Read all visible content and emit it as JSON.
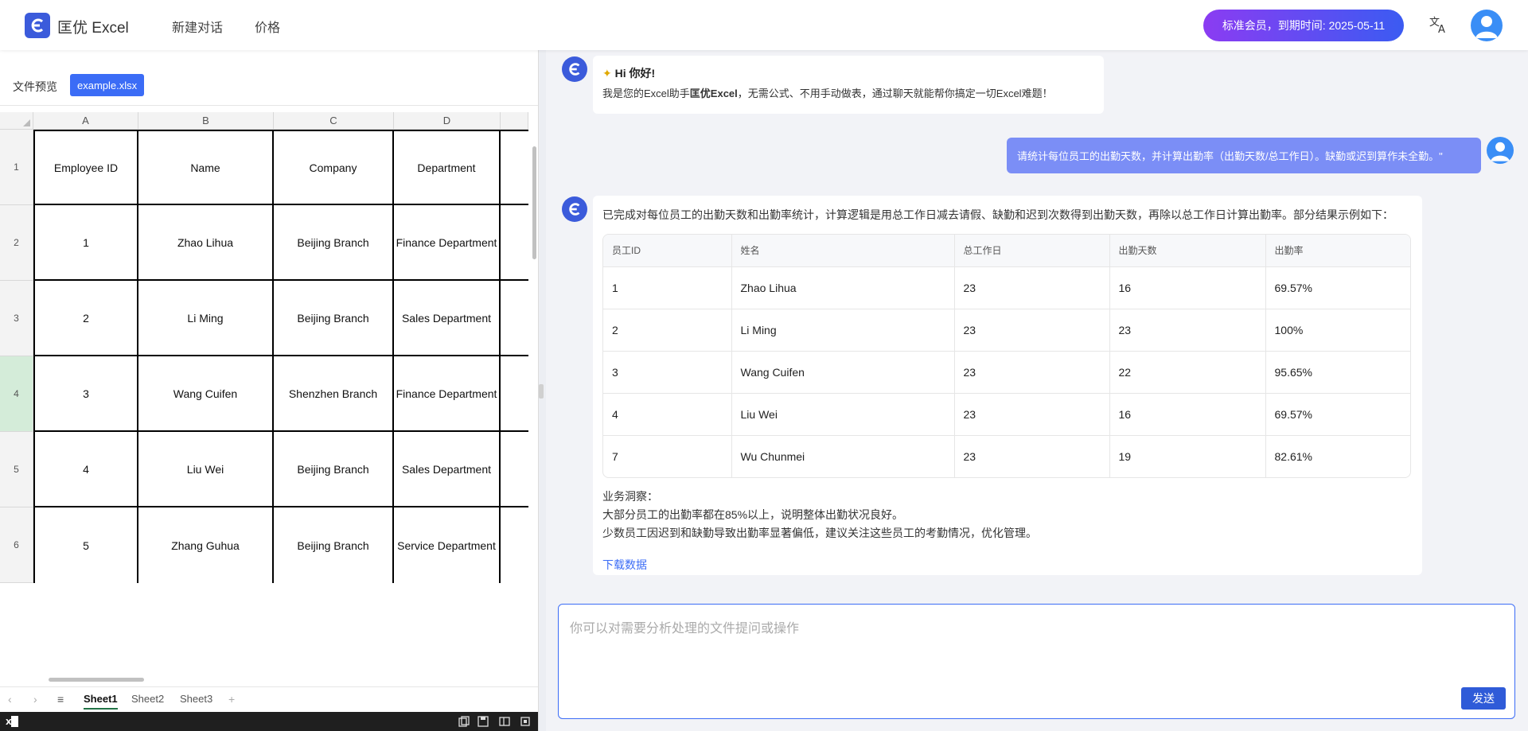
{
  "header": {
    "brand": "匡优 Excel",
    "nav": [
      "新建对话",
      "价格"
    ],
    "member_badge": "标准会员，到期时间: 2025-05-11"
  },
  "file_preview": {
    "label": "文件预览",
    "file_name": "example.xlsx"
  },
  "spreadsheet": {
    "columns": [
      "A",
      "B",
      "C",
      "D"
    ],
    "rows": [
      {
        "num": "1",
        "cells": [
          "Employee ID",
          "Name",
          "Company",
          "Department"
        ]
      },
      {
        "num": "2",
        "cells": [
          "1",
          "Zhao Lihua",
          "Beijing Branch",
          "Finance Department"
        ]
      },
      {
        "num": "3",
        "cells": [
          "2",
          "Li Ming",
          "Beijing Branch",
          "Sales Department"
        ]
      },
      {
        "num": "4",
        "cells": [
          "3",
          "Wang Cuifen",
          "Shenzhen Branch",
          "Finance Department"
        ]
      },
      {
        "num": "5",
        "cells": [
          "4",
          "Liu Wei",
          "Beijing Branch",
          "Sales Department"
        ]
      },
      {
        "num": "6",
        "cells": [
          "5",
          "Zhang Guhua",
          "Beijing Branch",
          "Service Department"
        ]
      }
    ],
    "selected_row": "4",
    "sheets": [
      "Sheet1",
      "Sheet2",
      "Sheet3"
    ],
    "active_sheet": "Sheet1",
    "add_sheet": "+"
  },
  "chat": {
    "greeting": {
      "title": "Hi 你好!",
      "text_prefix": "我是您的Excel助手",
      "text_bold": "匡优Excel",
      "text_suffix": "，无需公式、不用手动做表，通过聊天就能帮你搞定一切Excel难题！"
    },
    "user_message": "请统计每位员工的出勤天数，并计算出勤率（出勤天数/总工作日）。缺勤或迟到算作未全勤。\"",
    "result": {
      "intro": "已完成对每位员工的出勤天数和出勤率统计，计算逻辑是用总工作日减去请假、缺勤和迟到次数得到出勤天数，再除以总工作日计算出勤率。部分结果示例如下：",
      "table_headers": [
        "员工ID",
        "姓名",
        "总工作日",
        "出勤天数",
        "出勤率"
      ],
      "table_rows": [
        [
          "1",
          "Zhao Lihua",
          "23",
          "16",
          "69.57%"
        ],
        [
          "2",
          "Li Ming",
          "23",
          "23",
          "100%"
        ],
        [
          "3",
          "Wang Cuifen",
          "23",
          "22",
          "95.65%"
        ],
        [
          "4",
          "Liu Wei",
          "23",
          "16",
          "69.57%"
        ],
        [
          "7",
          "Wu Chunmei",
          "23",
          "19",
          "82.61%"
        ]
      ],
      "insight_title": "业务洞察：",
      "insight_lines": [
        "大部分员工的出勤率都在85%以上，说明整体出勤状况良好。",
        "少数员工因迟到和缺勤导致出勤率显著偏低，建议关注这些员工的考勤情况，优化管理。"
      ],
      "download": "下载数据"
    },
    "input_placeholder": "你可以对需要分析处理的文件提问或操作",
    "send_label": "发送"
  },
  "colors": {
    "brand": "#3b5bdb",
    "accent": "#3b6cf6",
    "user_bubble": "#7b8ef6",
    "selected_row": "#d4ecd9"
  }
}
